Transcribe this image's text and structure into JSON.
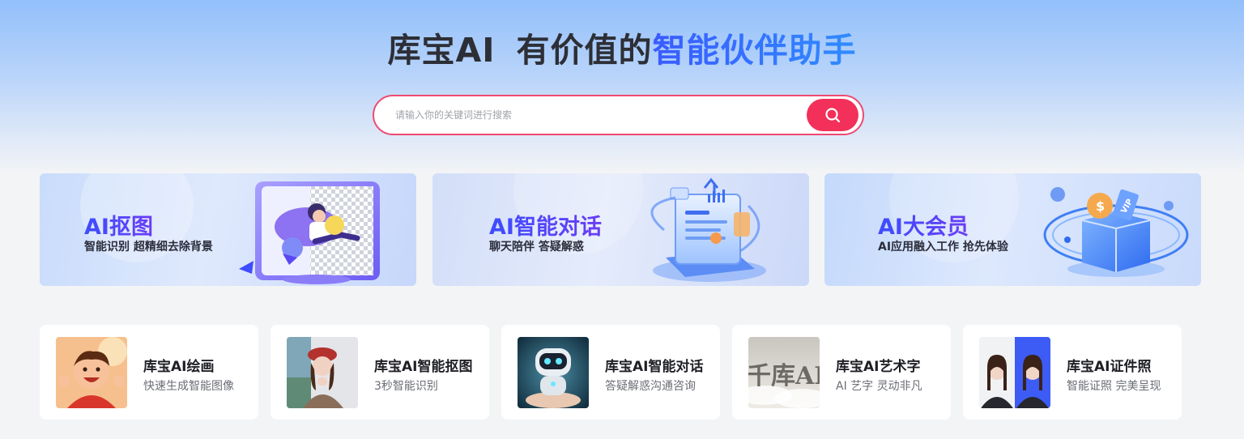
{
  "hero": {
    "title_brand": "库宝AI",
    "title_prefix": "有价值的",
    "title_accent": "智能伙伴助手"
  },
  "search": {
    "placeholder": "请输入你的关键词进行搜索",
    "value": "",
    "button_icon": "search-icon",
    "button_color": "#f3305a"
  },
  "banners": [
    {
      "title": "AI抠图",
      "subtitle": "智能识别 超精细去除背景",
      "icon": "cutout-illustration"
    },
    {
      "title": "AI智能对话",
      "subtitle": "聊天陪伴 答疑解惑",
      "icon": "chat-illustration"
    },
    {
      "title": "AI大会员",
      "subtitle": "AI应用融入工作 抢先体验",
      "icon": "vip-illustration"
    }
  ],
  "tools": [
    {
      "title": "库宝AI绘画",
      "desc": "快速生成智能图像",
      "thumb": "cartoon-boy-thumb"
    },
    {
      "title": "库宝AI智能抠图",
      "desc": "3秒智能识别",
      "thumb": "woman-portrait-thumb"
    },
    {
      "title": "库宝AI智能对话",
      "desc": "答疑解惑沟通咨询",
      "thumb": "robot-thumb"
    },
    {
      "title": "库宝AI艺术字",
      "desc": "AI 艺字 灵动非凡",
      "thumb": "art-text-thumb",
      "thumb_text": "千库AI"
    },
    {
      "title": "库宝AI证件照",
      "desc": "智能证照 完美呈现",
      "thumb": "id-photo-thumb"
    }
  ],
  "colors": {
    "accent_blue": "#3a5bff",
    "accent_red": "#f3305a",
    "page_bg": "#f3f4f6"
  }
}
